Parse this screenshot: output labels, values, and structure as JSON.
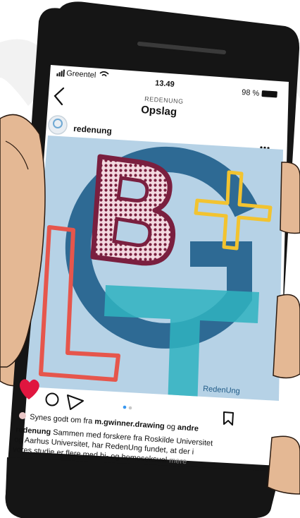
{
  "status_bar": {
    "carrier": "Greentel",
    "time": "13.49",
    "battery": "98 %"
  },
  "nav": {
    "subtitle": "REDENUNG",
    "title": "Opslag"
  },
  "post": {
    "username": "redenung",
    "watermark": "RedenUng",
    "likes_text_prefix": "Synes godt om fra",
    "likes_user": "m.gwinner.drawing",
    "likes_text_mid": "og",
    "likes_others": "andre",
    "caption_user": "redenung",
    "caption_line1": "Sammen med forskere fra Roskilde Universitet",
    "caption_line2": "og Aarhus Universitet, har RedenUng fundet, at der i",
    "caption_line3": "vores studie er flere med bi- og homoseksuel",
    "more": "mere"
  },
  "colors": {
    "phone": "#151515",
    "screen_bg": "#ffffff",
    "image_bg": "#b6d2e6",
    "g_blue": "#27648f",
    "b_maroon": "#7a1f3f",
    "plus_yellow": "#f2c330",
    "l_red": "#e6564c",
    "t_teal": "#2fb3bf",
    "heart_red": "#e0163f",
    "skin": "#e4b894"
  }
}
